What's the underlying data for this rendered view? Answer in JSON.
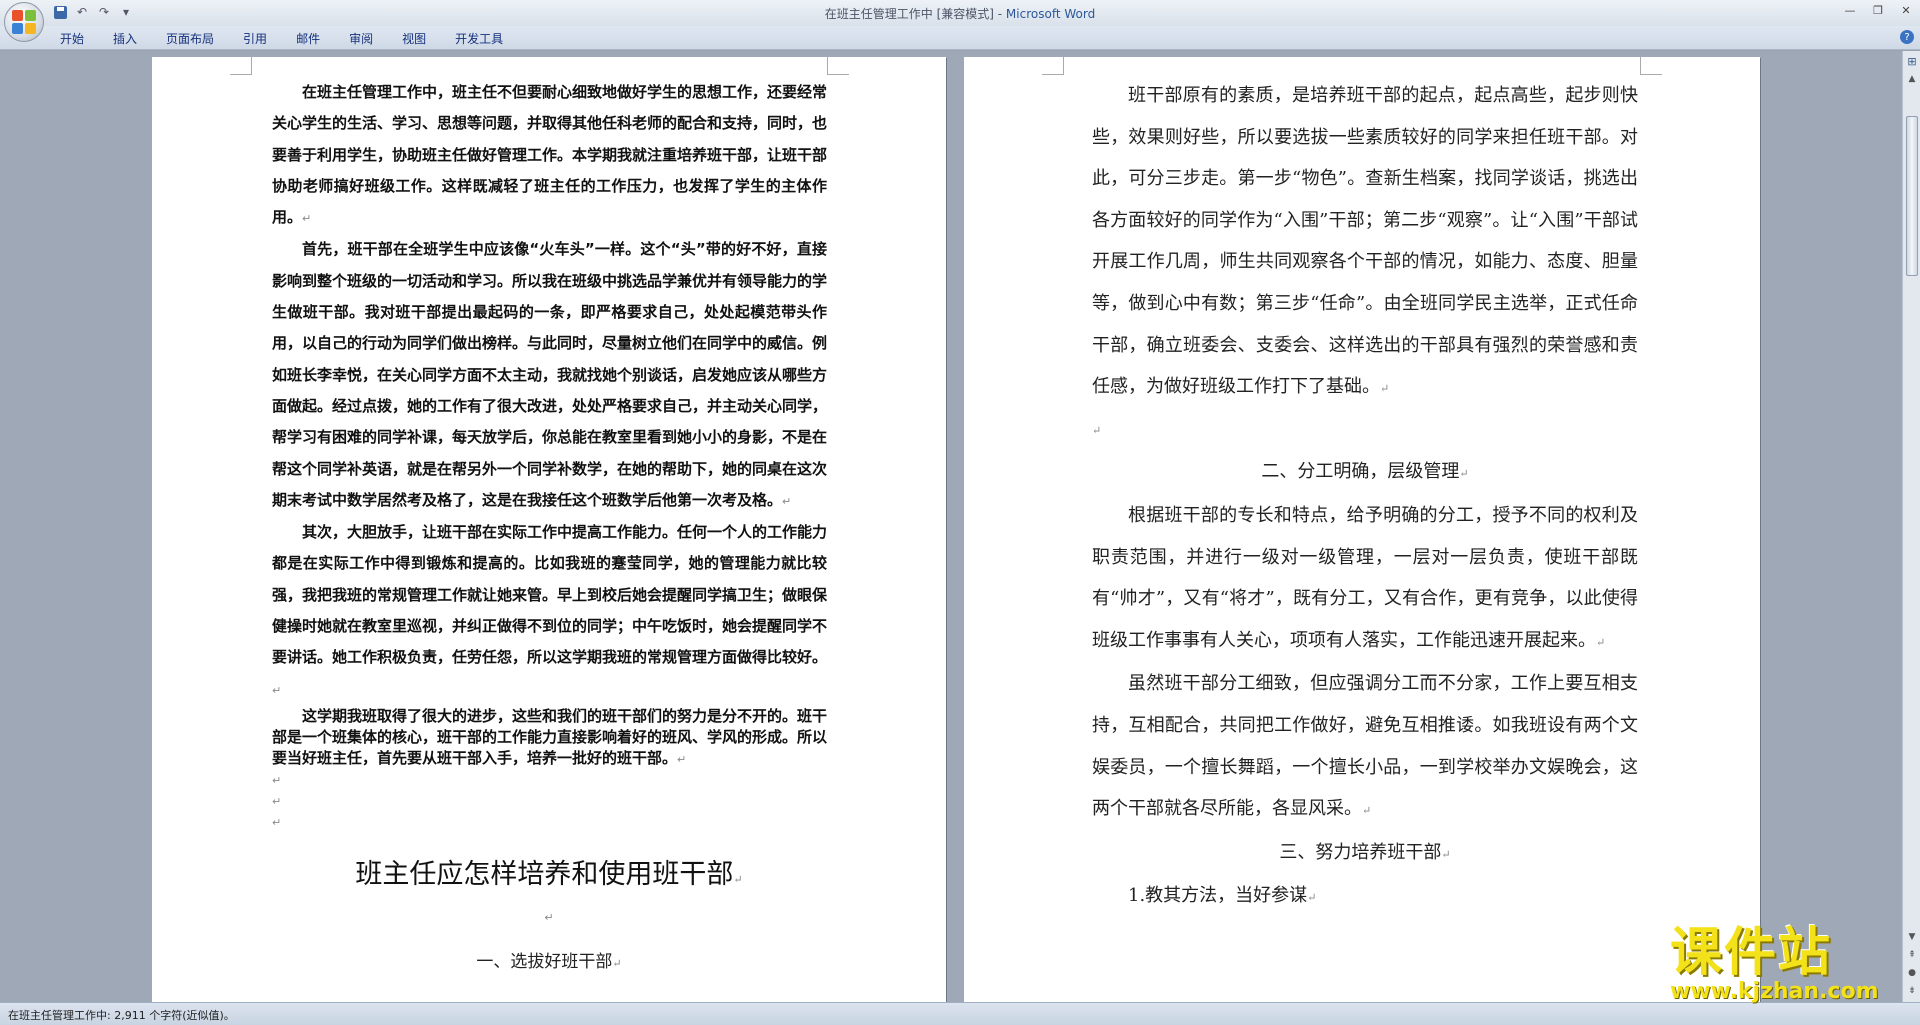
{
  "window": {
    "title_doc": "在班主任管理工作中 [兼容模式] - ",
    "title_app": "Microsoft Word"
  },
  "quick_access": {
    "icons": [
      "save-icon",
      "undo-icon",
      "redo-icon",
      "customize-icon"
    ],
    "undo_glyph": "↶",
    "redo_glyph": "↷",
    "customize_glyph": "▾"
  },
  "window_controls": {
    "minimize": "—",
    "restore": "❐",
    "close": "✕"
  },
  "ribbon": {
    "tabs": [
      "开始",
      "插入",
      "页面布局",
      "引用",
      "邮件",
      "审阅",
      "视图",
      "开发工具"
    ],
    "help": "?"
  },
  "page1": {
    "paragraphs": [
      "在班主任管理工作中，班主任不但要耐心细致地做好学生的思想工作，还要经常关心学生的生活、学习、思想等问题，并取得其他任科老师的配合和支持，同时，也要善于利用学生，协助班主任做好管理工作。本学期我就注重培养班干部，让班干部协助老师搞好班级工作。这样既减轻了班主任的工作压力，也发挥了学生的主体作用。",
      "首先，班干部在全班学生中应该像“火车头”一样。这个“头”带的好不好，直接影响到整个班级的一切活动和学习。所以我在班级中挑选品学兼优并有领导能力的学生做班干部。我对班干部提出最起码的一条，即严格要求自己，处处起模范带头作用，以自己的行动为同学们做出榜样。与此同时，尽量树立他们在同学中的威信。例如班长李幸悦，在关心同学方面不太主动，我就找她个别谈话，启发她应该从哪些方面做起。经过点拨，她的工作有了很大改进，处处严格要求自己，并主动关心同学，帮学习有困难的同学补课，每天放学后，你总能在教室里看到她小小的身影，不是在帮这个同学补英语，就是在帮另外一个同学补数学，在她的帮助下，她的同桌在这次期末考试中数学居然考及格了，这是在我接任这个班数学后他第一次考及格。",
      "其次，大胆放手，让班干部在实际工作中提高工作能力。任何一个人的工作能力都是在实际工作中得到锻炼和提高的。比如我班的蹇莹同学，她的管理能力就比较强，我把我班的常规管理工作就让她来管。早上到校后她会提醒同学搞卫生；做眼保健操时她就在教室里巡视，并纠正做得不到位的同学；中午吃饭时，她会提醒同学不要讲话。她工作积极负责，任劳任怨，所以这学期我班的常规管理方面做得比较好。",
      "这学期我班取得了很大的进步，这些和我们的班干部们的努力是分不开的。班干部是一个班集体的核心，班干部的工作能力直接影响着好的班风、学风的形成。所以要当好班主任，首先要从班干部入手，培养一批好的班干部。"
    ],
    "title": "班主任应怎样培养和使用班干部",
    "section1": "一、选拔好班干部"
  },
  "page2": {
    "para1": "班干部原有的素质，是培养班干部的起点，起点高些，起步则快些，效果则好些，所以要选拔一些素质较好的同学来担任班干部。对此，可分三步走。第一步“物色”。查新生档案，找同学谈话，挑选出各方面较好的同学作为“入围”干部；第二步“观察”。让“入围”干部试开展工作几周，师生共同观察各个干部的情况，如能力、态度、胆量等，做到心中有数；第三步“任命”。由全班同学民主选举，正式任命干部，确立班委会、支委会、这样选出的干部具有强烈的荣誉感和责任感，为做好班级工作打下了基础。",
    "heading2": "二、分工明确，层级管理",
    "para2": "根据班干部的专长和特点，给予明确的分工，授予不同的权利及职责范围，并进行一级对一级管理，一层对一层负责，使班干部既有“帅才”，又有“将才”，既有分工，又有合作，更有竞争，以此使得班级工作事事有人关心，项项有人落实，工作能迅速开展起来。",
    "para3": "虽然班干部分工细致，但应强调分工而不分家，工作上要互相支持，互相配合，共同把工作做好，避免互相推诿。如我班设有两个文娱委员，一个擅长舞蹈，一个擅长小品，一到学校举办文娱晚会，这两个干部就各尽所能，各显风采。",
    "heading3": "三、努力培养班干部",
    "item1": "1.教其方法，当好参谋"
  },
  "paragraph_mark": "↵",
  "statusbar": {
    "text": "在班主任管理工作中: 2,911 个字符(近似值)。"
  },
  "watermark": {
    "cn": "课件站",
    "url": "www.kjzhan.com"
  },
  "colors": {
    "accent": "#2b579a",
    "watermark": "#f3e21a"
  }
}
